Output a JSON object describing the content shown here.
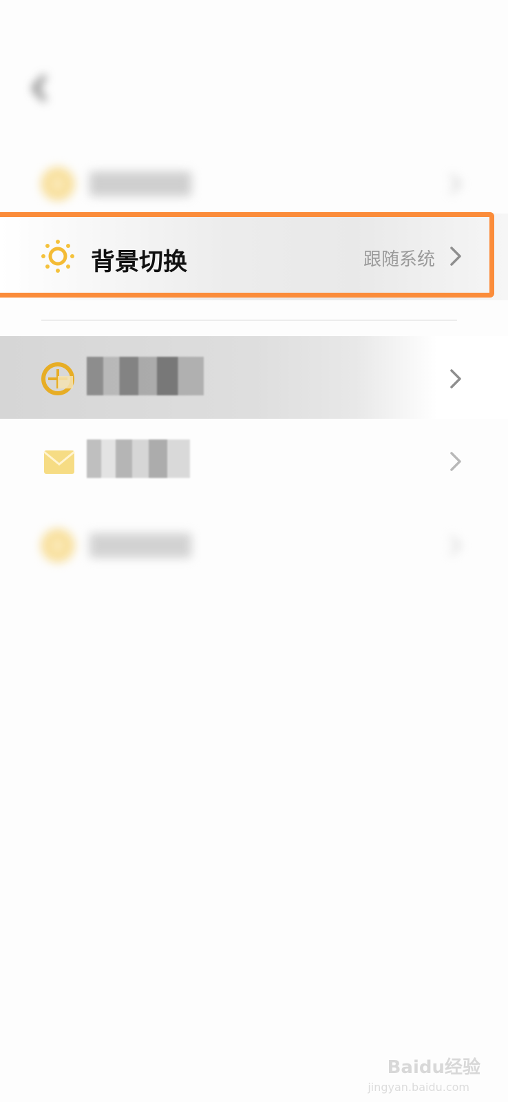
{
  "status_bar": {
    "left_text": "",
    "right_text": ""
  },
  "nav": {
    "title": ""
  },
  "settings": {
    "notify": {
      "label": "",
      "value": ""
    },
    "theme": {
      "label": "背景切换",
      "value": "跟随系统"
    },
    "update": {
      "label": "",
      "value": ""
    },
    "contact": {
      "label": "",
      "value": ""
    },
    "about": {
      "label": "",
      "value": ""
    }
  },
  "colors": {
    "accent_orange": "#fb8c3a",
    "icon_yellow": "#f4c23c",
    "label_dark": "#111111",
    "value_gray": "#9a9a9a"
  },
  "icons": {
    "back": "chevron-left-icon",
    "theme": "sun-icon",
    "update": "globe-icon",
    "contact": "mail-icon",
    "chevron": "chevron-right-icon"
  },
  "watermark": {
    "brand": "Baidu经验",
    "url": "jingyan.baidu.com"
  }
}
